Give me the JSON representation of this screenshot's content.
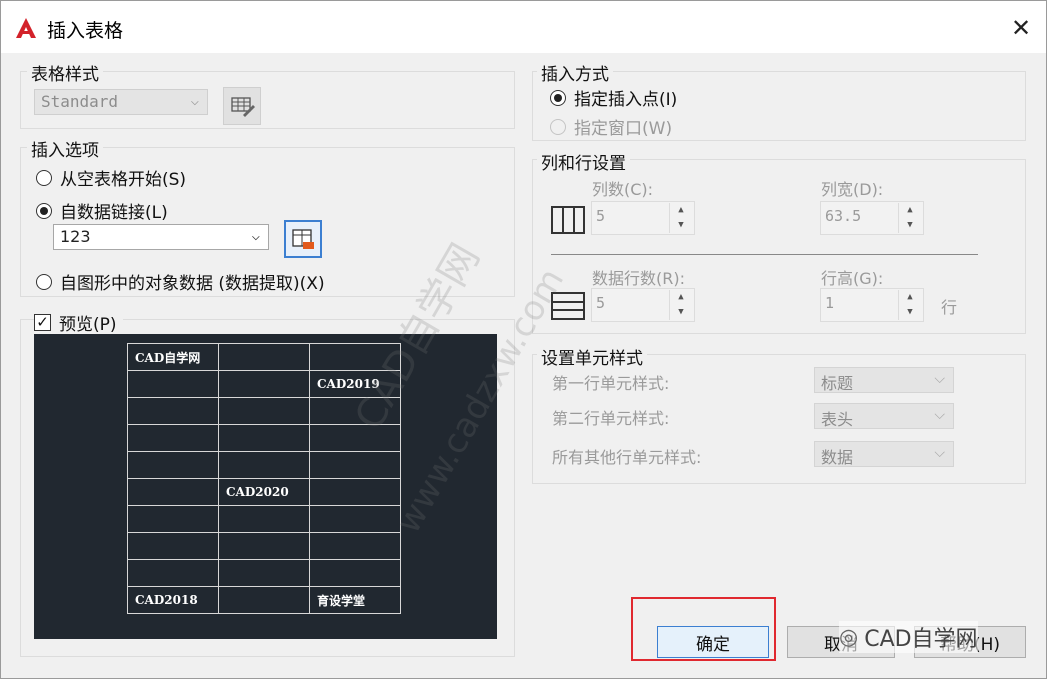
{
  "window": {
    "title": "插入表格"
  },
  "table_style": {
    "label": "表格样式",
    "selected": "Standard"
  },
  "insert_options": {
    "label": "插入选项",
    "options": [
      "从空表格开始(S)",
      "自数据链接(L)",
      "自图形中的对象数据 (数据提取)(X)"
    ],
    "selected_index": 1,
    "data_link_value": "123"
  },
  "preview": {
    "label": "预览(P)",
    "checked": true,
    "rows": [
      [
        "CAD自学网",
        "",
        ""
      ],
      [
        "",
        "",
        "CAD2019"
      ],
      [
        "",
        "",
        ""
      ],
      [
        "",
        "",
        ""
      ],
      [
        "",
        "",
        ""
      ],
      [
        "",
        "CAD2020",
        ""
      ],
      [
        "",
        "",
        ""
      ],
      [
        "",
        "",
        ""
      ],
      [
        "",
        "",
        ""
      ],
      [
        "CAD2018",
        "",
        "育设学堂"
      ]
    ]
  },
  "insert_method": {
    "label": "插入方式",
    "options": [
      "指定插入点(I)",
      "指定窗口(W)"
    ],
    "selected_index": 0
  },
  "col_row_settings": {
    "label": "列和行设置",
    "columns_label": "列数(C):",
    "columns_value": "5",
    "col_width_label": "列宽(D):",
    "col_width_value": "63.5",
    "data_rows_label": "数据行数(R):",
    "data_rows_value": "5",
    "row_height_label": "行高(G):",
    "row_height_value": "1",
    "row_height_unit": "行"
  },
  "cell_styles": {
    "label": "设置单元样式",
    "first_row_label": "第一行单元样式:",
    "first_row_value": "标题",
    "second_row_label": "第二行单元样式:",
    "second_row_value": "表头",
    "other_rows_label": "所有其他行单元样式:",
    "other_rows_value": "数据"
  },
  "buttons": {
    "ok": "确定",
    "cancel": "取消",
    "help": "帮助(H)"
  },
  "watermarks": {
    "diagonal_1": "CAD自学网",
    "diagonal_2": "www.cadzxw.com",
    "corner": "CAD自学网"
  },
  "colors": {
    "preview_bg": "#212830",
    "highlight_box": "#e0282f",
    "ok_button_border": "#3c7fd1"
  }
}
